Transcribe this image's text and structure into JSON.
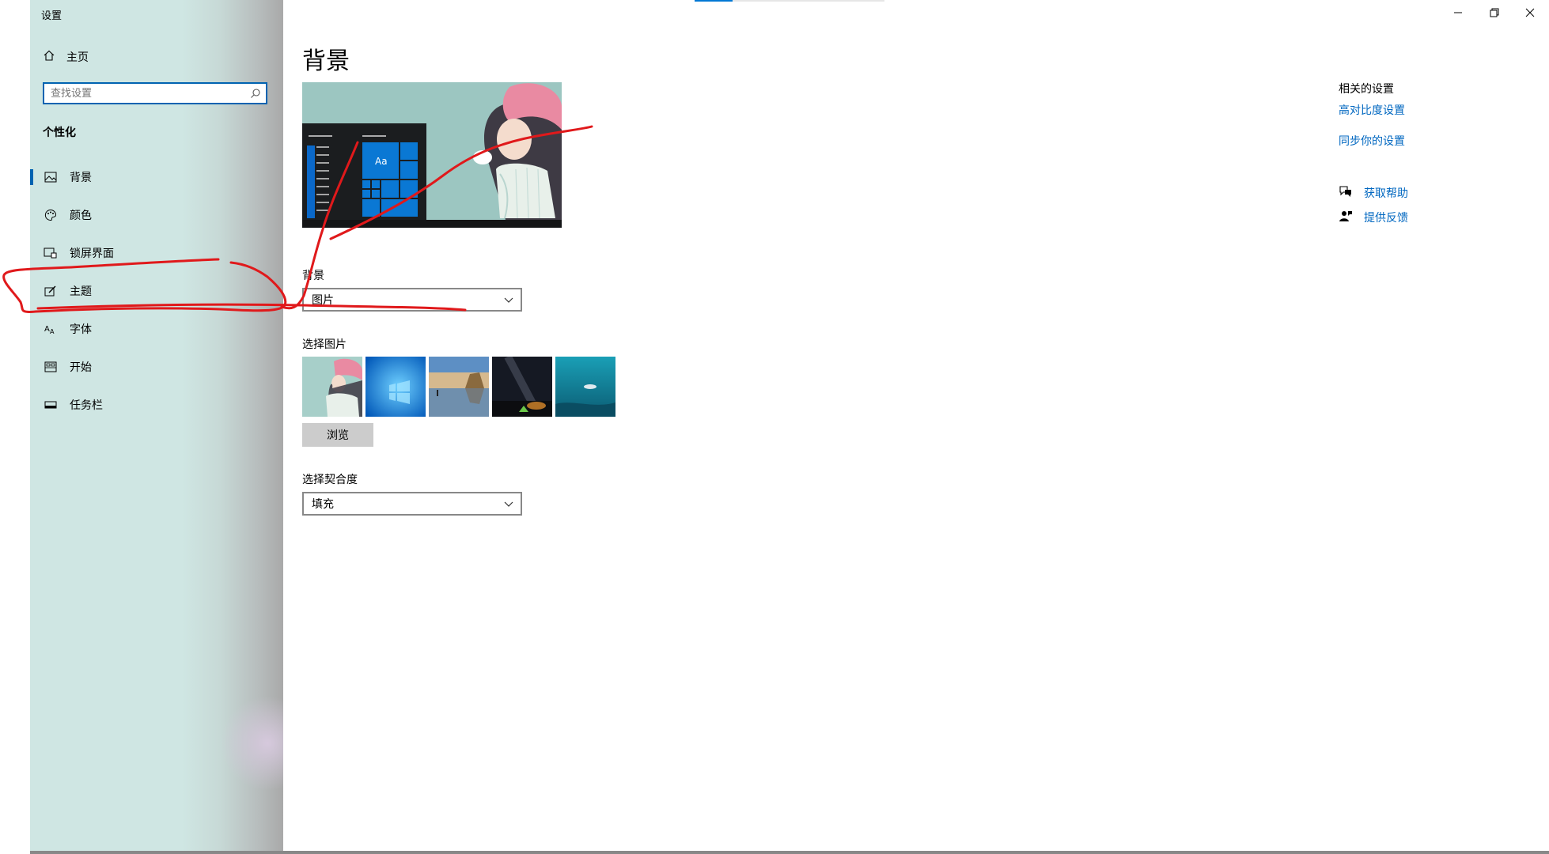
{
  "window": {
    "title": "设置"
  },
  "sidebar": {
    "home_label": "主页",
    "search_placeholder": "查找设置",
    "section_title": "个性化",
    "items": [
      {
        "label": "背景",
        "icon": "picture-icon",
        "active": true
      },
      {
        "label": "颜色",
        "icon": "palette-icon",
        "active": false
      },
      {
        "label": "锁屏界面",
        "icon": "lock-screen-icon",
        "active": false
      },
      {
        "label": "主题",
        "icon": "theme-brush-icon",
        "active": false
      },
      {
        "label": "字体",
        "icon": "font-icon",
        "active": false
      },
      {
        "label": "开始",
        "icon": "start-menu-icon",
        "active": false
      },
      {
        "label": "任务栏",
        "icon": "taskbar-icon",
        "active": false
      }
    ]
  },
  "main": {
    "page_title": "背景",
    "preview": {
      "tile_label": "Aa"
    },
    "background_label": "背景",
    "background_value": "图片",
    "choose_picture_label": "选择图片",
    "browse_label": "浏览",
    "fit_label": "选择契合度",
    "fit_value": "填充"
  },
  "related": {
    "title": "相关的设置",
    "links": [
      "高对比度设置",
      "同步你的设置"
    ],
    "help_label": "获取帮助",
    "feedback_label": "提供反馈"
  },
  "colors": {
    "accent": "#0063b1",
    "link": "#0067c0",
    "annotation": "#e0191b"
  }
}
